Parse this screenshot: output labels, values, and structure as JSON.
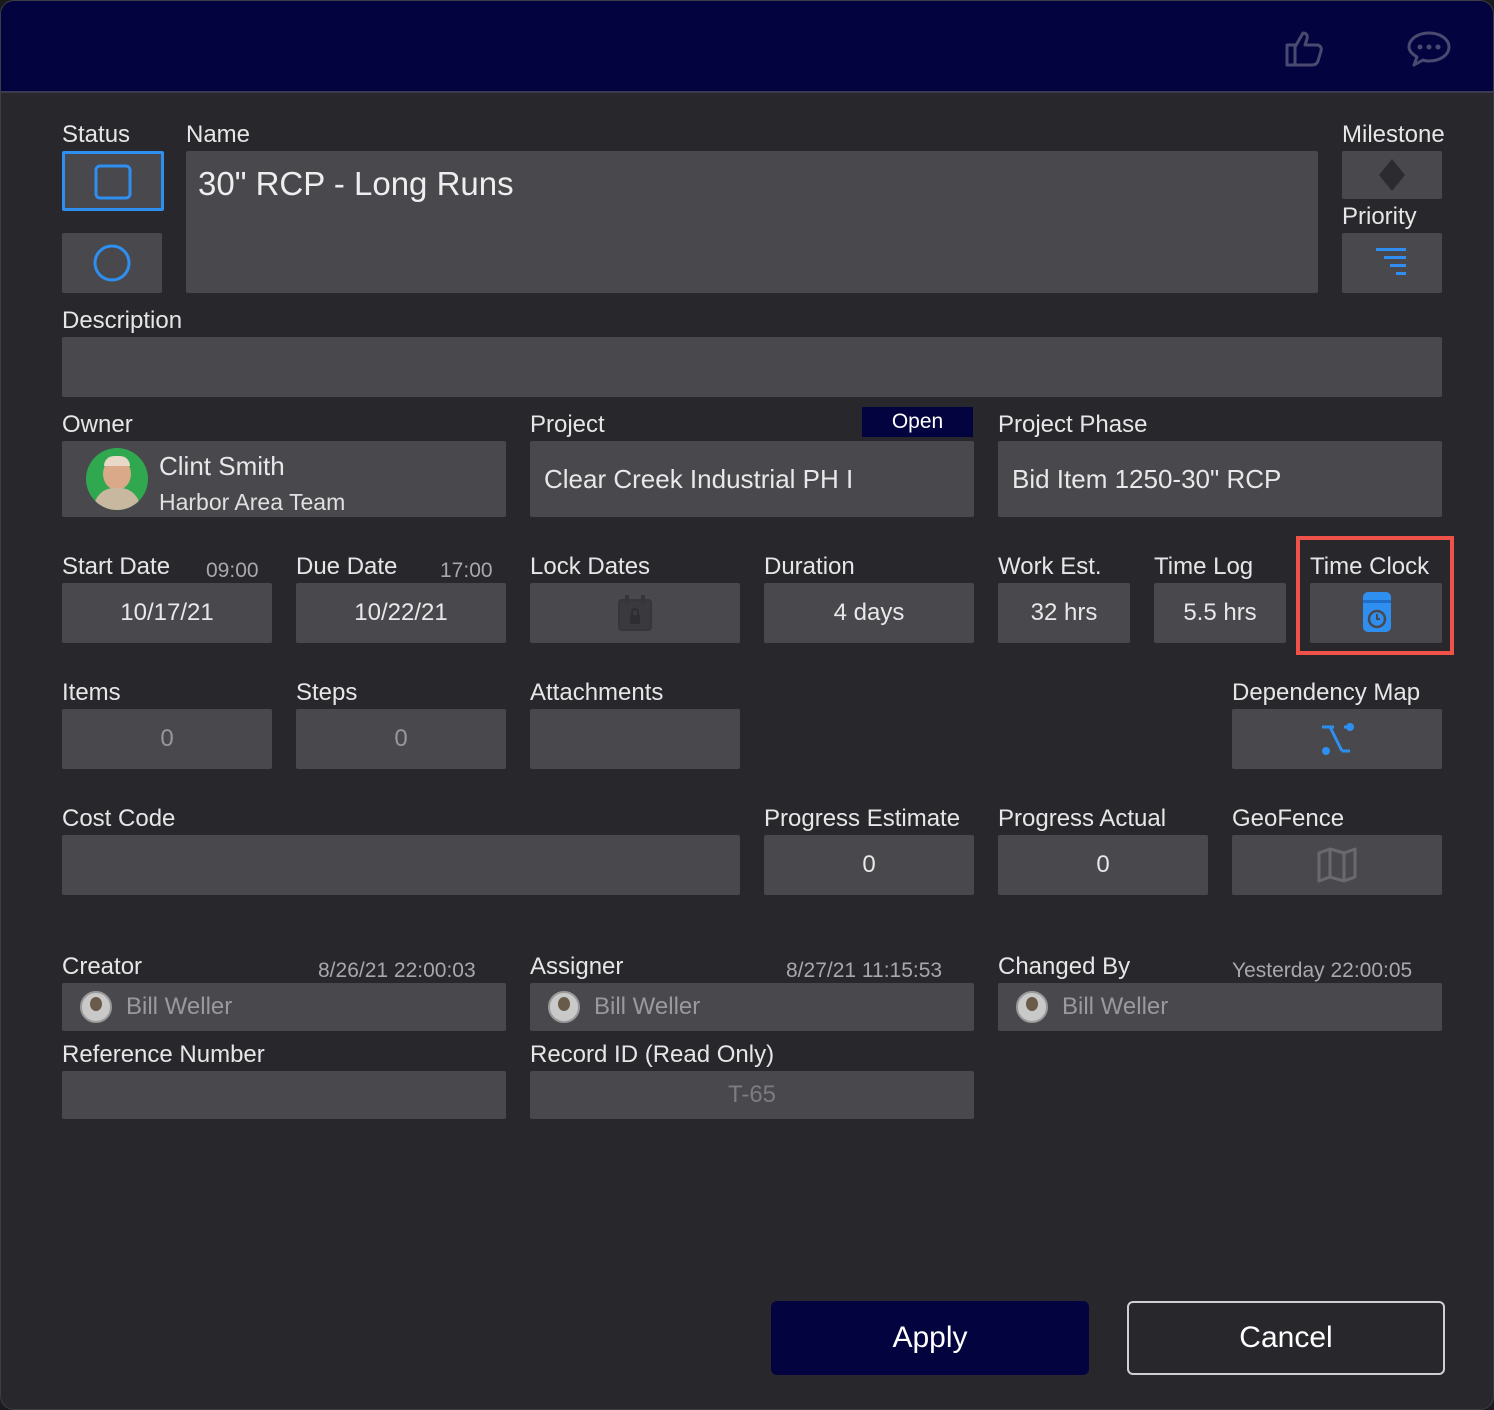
{
  "toolbar": {
    "like_icon": "thumbs-up-outline-icon",
    "comment_icon": "comment-dots-icon"
  },
  "labels": {
    "status": "Status",
    "name": "Name",
    "milestone": "Milestone",
    "priority": "Priority",
    "description": "Description",
    "owner": "Owner",
    "project": "Project",
    "project_phase": "Project Phase",
    "start_date": "Start Date",
    "due_date": "Due Date",
    "lock_dates": "Lock Dates",
    "duration": "Duration",
    "work_est": "Work Est.",
    "time_log": "Time Log",
    "time_clock": "Time Clock",
    "items": "Items",
    "steps": "Steps",
    "attachments": "Attachments",
    "dependency_map": "Dependency Map",
    "cost_code": "Cost Code",
    "progress_estimate": "Progress Estimate",
    "progress_actual": "Progress Actual",
    "geofence": "GeoFence",
    "creator": "Creator",
    "assigner": "Assigner",
    "changed_by": "Changed By",
    "reference_number": "Reference Number",
    "record_id": "Record ID (Read Only)"
  },
  "fields": {
    "name": "30\" RCP - Long Runs",
    "description": "",
    "owner_name": "Clint Smith",
    "owner_team": "Harbor Area Team",
    "project": "Clear Creek Industrial PH I",
    "project_badge": "Open",
    "project_phase": "Bid Item 1250-30\" RCP",
    "start_time": "09:00",
    "start_date": "10/17/21",
    "due_time": "17:00",
    "due_date": "10/22/21",
    "duration": "4 days",
    "work_est": "32 hrs",
    "time_log": "5.5 hrs",
    "items": "0",
    "steps": "0",
    "attachments": "",
    "cost_code": "",
    "progress_estimate": "0",
    "progress_actual": "0",
    "creator_time": "8/26/21  22:00:03",
    "creator_name": "Bill Weller",
    "assigner_time": "8/27/21  11:15:53",
    "assigner_name": "Bill Weller",
    "changed_time": "Yesterday  22:00:05",
    "changed_name": "Bill Weller",
    "reference_number": "",
    "record_id": "T-65"
  },
  "buttons": {
    "apply": "Apply",
    "cancel": "Cancel"
  },
  "colors": {
    "accent_blue": "#2f8ff0",
    "header_navy": "#03033f",
    "highlight_red": "#f0524a"
  }
}
